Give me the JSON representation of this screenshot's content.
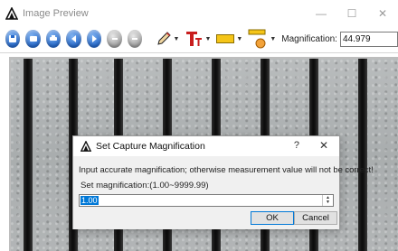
{
  "window": {
    "title": "Image Preview",
    "controls": {
      "minimize": "—",
      "maximize": "☐",
      "close": "✕"
    }
  },
  "toolbar": {
    "buttons": [
      {
        "icon": "save-icon",
        "color": "#2467c9"
      },
      {
        "icon": "open-icon",
        "color": "#2467c9"
      },
      {
        "icon": "print-icon",
        "color": "#2467c9"
      },
      {
        "icon": "back-icon",
        "color": "#2467c9"
      },
      {
        "icon": "forward-icon",
        "color": "#2467c9"
      },
      {
        "icon": "undo-icon",
        "color": "#9c9c9c"
      },
      {
        "icon": "redo-icon",
        "color": "#9c9c9c"
      }
    ],
    "tools": [
      {
        "icon": "pencil-icon"
      },
      {
        "icon": "text-size-icon"
      },
      {
        "icon": "color-swatch-icon"
      },
      {
        "icon": "ruler-icon"
      }
    ],
    "magnification_label": "Magnification:",
    "magnification_value": "44.979"
  },
  "dialog": {
    "title": "Set Capture Magnification",
    "help": "?",
    "close": "✕",
    "message": "Input accurate magnification; otherwise measurement value will not be correct!",
    "field_label": "Set magnification:(1.00~9999.99)",
    "field_value": "1.00",
    "ok_label": "OK",
    "cancel_label": "Cancel"
  },
  "colors": {
    "accent": "#0078d7",
    "toolbar_blue": "#2467c9"
  }
}
